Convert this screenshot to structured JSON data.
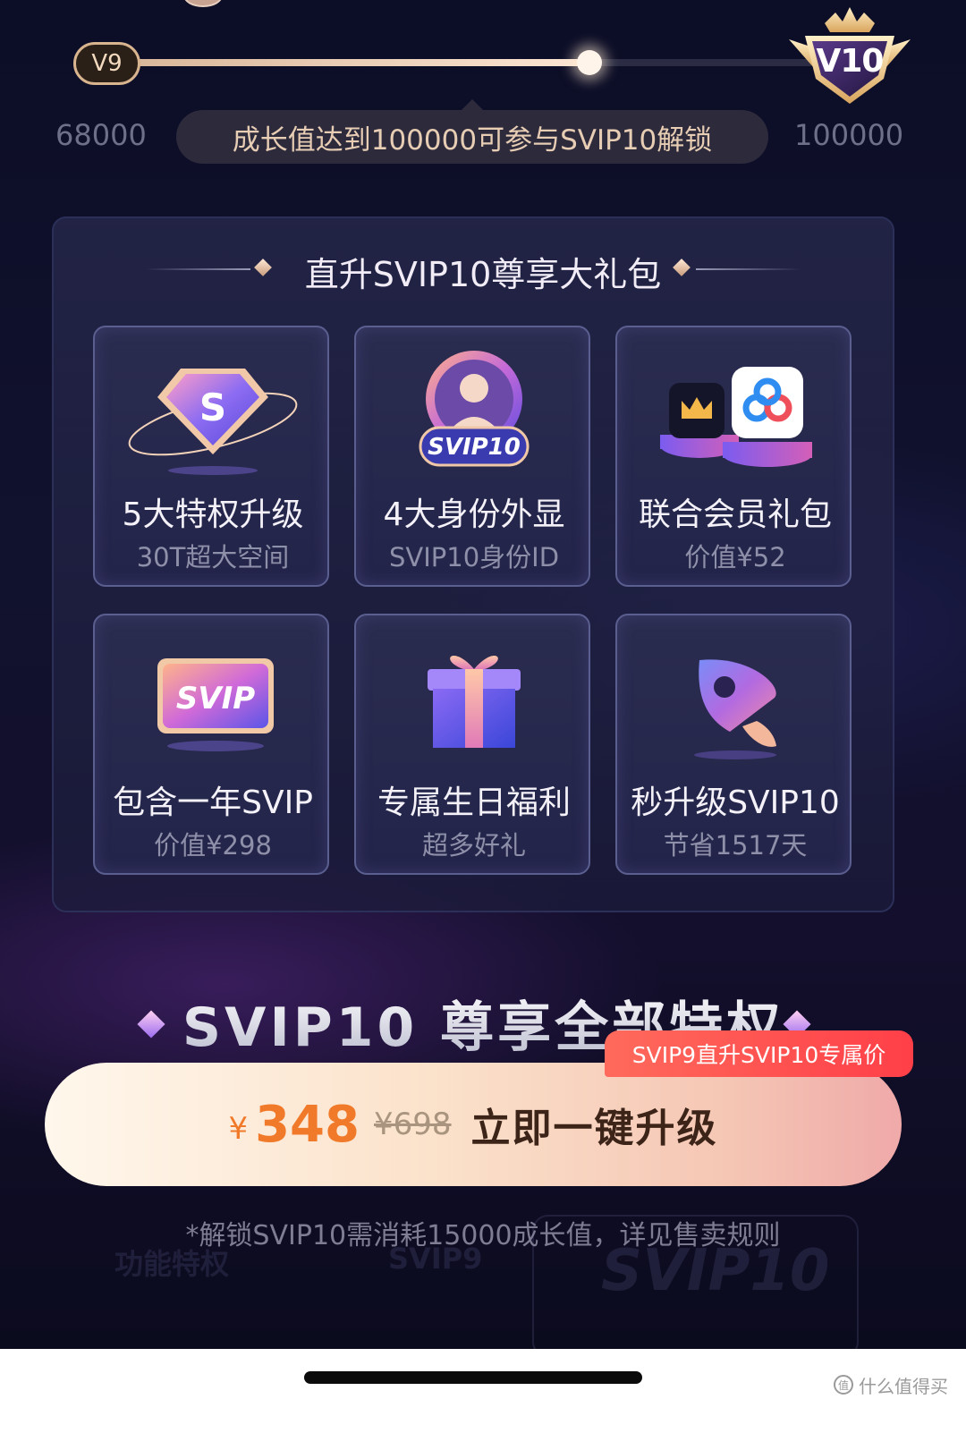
{
  "progress": {
    "current_level": "V9",
    "next_level": "V10",
    "start_value": "68000",
    "end_value": "100000",
    "fill_fraction": 0.67,
    "tooltip": "成长值达到100000可参与SVIP10解锁"
  },
  "gift_pack": {
    "title": "直升SVIP10尊享大礼包",
    "cards": [
      {
        "title": "5大特权升级",
        "sub": "30T超大空间",
        "icon": "s-diamond-icon",
        "art_text": "S"
      },
      {
        "title": "4大身份外显",
        "sub": "SVIP10身份ID",
        "icon": "svip10-avatar-badge-icon",
        "art_text": "SVIP10"
      },
      {
        "title": "联合会员礼包",
        "sub": "价值¥52",
        "icon": "partner-apps-icon"
      },
      {
        "title": "包含一年SVIP",
        "sub": "价值¥298",
        "icon": "svip-card-icon",
        "art_text": "SVIP"
      },
      {
        "title": "专属生日福利",
        "sub": "超多好礼",
        "icon": "gift-box-icon"
      },
      {
        "title": "秒升级SVIP10",
        "sub": "节省1517天",
        "icon": "rocket-icon"
      }
    ]
  },
  "headline": "SVIP10 尊享全部特权",
  "promo_tag": "SVIP9直升SVIP10专属价",
  "cta": {
    "currency": "¥",
    "price": "348",
    "original_price": "¥698",
    "label": "立即一键升级"
  },
  "footnote": "*解锁SVIP10需消耗15000成长值，详见售卖规则",
  "ghost_table": {
    "col1": "功能特权",
    "col2": "SVIP9",
    "col3": "SVIP10"
  },
  "watermark": "什么值得买",
  "colors": {
    "accent_orange": "#f07a2a",
    "gold": "#d8b48f",
    "promo_red": "#ff3f48",
    "bg_dark": "#11122e"
  }
}
